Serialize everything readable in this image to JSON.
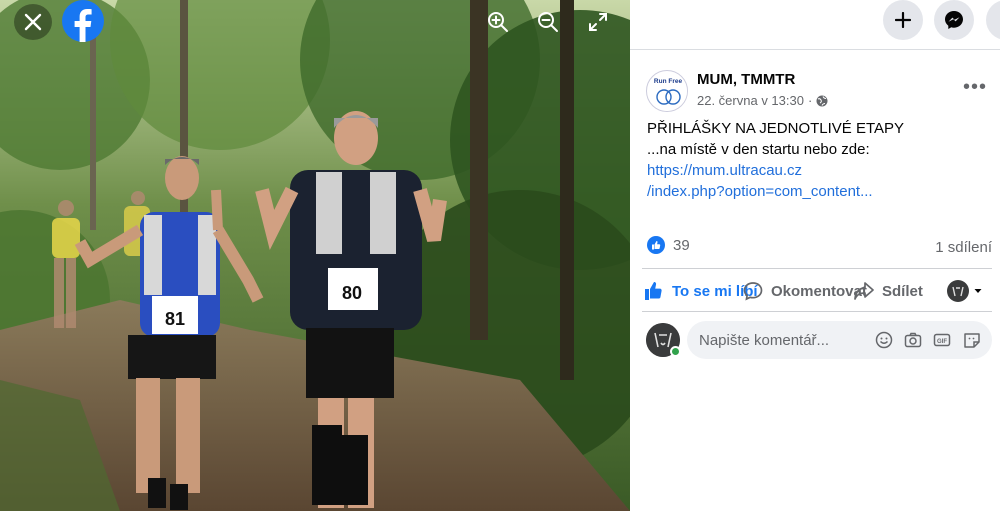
{
  "viewer": {
    "icons": [
      "close-icon",
      "facebook-logo",
      "zoom-in-icon",
      "zoom-out-icon",
      "fullscreen-icon"
    ],
    "photo": {
      "left_bib": "81",
      "right_bib": "80"
    }
  },
  "header": {
    "icons": [
      "plus-icon",
      "messenger-icon"
    ]
  },
  "post": {
    "page_name": "MUM, TMMTR",
    "date": "22. června v 13:30",
    "dot_separator": "·",
    "privacy_icon": "globe-icon",
    "avatar_text": "Run Free",
    "more_label": "•••",
    "text_line1": "PŘIHLÁŠKY NA JEDNOTLIVÉ ETAPY",
    "text_line2": "...na místě v den startu nebo zde:",
    "link_line1": "https://mum.ultracau.cz",
    "link_line2": "/index.php?option=com_content...",
    "like_count": "39",
    "shares": "1 sdílení"
  },
  "actions": {
    "like": "To se mi líbí",
    "comment": "Okomentovat",
    "share": "Sdílet"
  },
  "comment": {
    "placeholder": "Napište komentář..."
  },
  "colors": {
    "accent": "#1877f2",
    "link": "#216fdb",
    "online": "#31a24c"
  }
}
